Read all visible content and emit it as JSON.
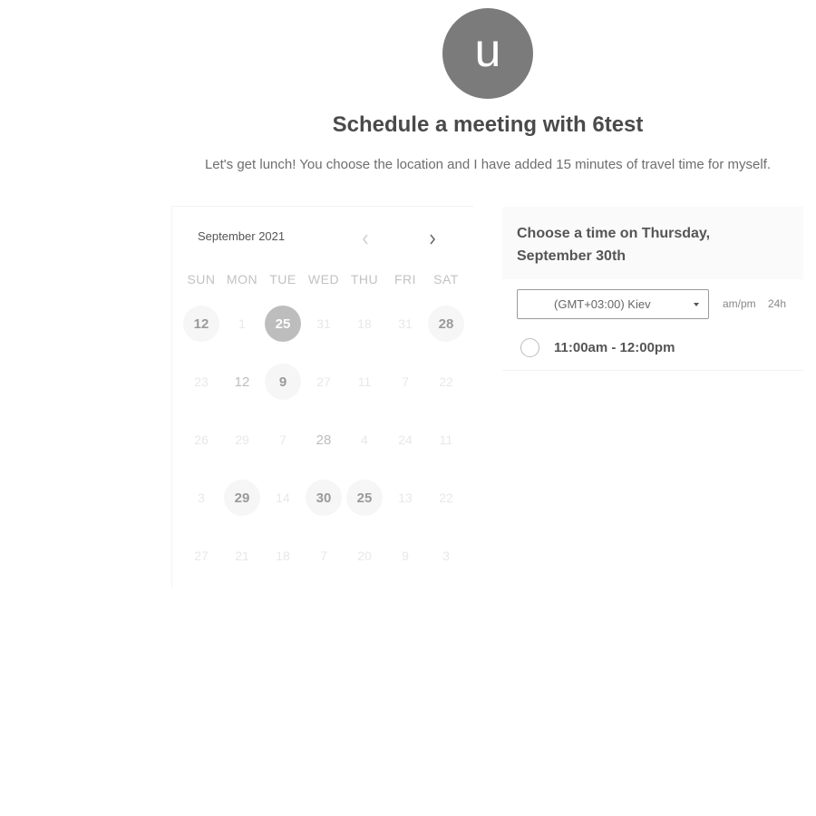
{
  "host": {
    "avatar_initial": "u",
    "title": "Schedule a meeting with 6test",
    "description": "Let's get lunch! You choose the location and I have added 15 minutes of travel time for myself."
  },
  "calendar": {
    "month_label": "September 2021",
    "prev_icon": "chevron-left-icon",
    "next_icon": "chevron-right-icon",
    "weekdays": [
      "SUN",
      "MON",
      "TUE",
      "WED",
      "THU",
      "FRI",
      "SAT"
    ],
    "weeks": [
      [
        {
          "label": "12",
          "state": "available"
        },
        {
          "label": "1",
          "state": "disabled"
        },
        {
          "label": "25",
          "state": "selected"
        },
        {
          "label": "31",
          "state": "disabled"
        },
        {
          "label": "18",
          "state": "disabled"
        },
        {
          "label": "31",
          "state": "disabled"
        },
        {
          "label": "28",
          "state": "available"
        }
      ],
      [
        {
          "label": "23",
          "state": "disabled"
        },
        {
          "label": "12",
          "state": "muted"
        },
        {
          "label": "9",
          "state": "available"
        },
        {
          "label": "27",
          "state": "disabled"
        },
        {
          "label": "11",
          "state": "disabled"
        },
        {
          "label": "7",
          "state": "disabled"
        },
        {
          "label": "22",
          "state": "disabled"
        }
      ],
      [
        {
          "label": "26",
          "state": "disabled"
        },
        {
          "label": "29",
          "state": "disabled"
        },
        {
          "label": "7",
          "state": "disabled"
        },
        {
          "label": "28",
          "state": "muted"
        },
        {
          "label": "4",
          "state": "disabled"
        },
        {
          "label": "24",
          "state": "disabled"
        },
        {
          "label": "11",
          "state": "disabled"
        }
      ],
      [
        {
          "label": "3",
          "state": "disabled"
        },
        {
          "label": "29",
          "state": "available"
        },
        {
          "label": "14",
          "state": "disabled"
        },
        {
          "label": "30",
          "state": "available"
        },
        {
          "label": "25",
          "state": "available"
        },
        {
          "label": "13",
          "state": "disabled"
        },
        {
          "label": "22",
          "state": "disabled"
        }
      ],
      [
        {
          "label": "27",
          "state": "disabled"
        },
        {
          "label": "21",
          "state": "disabled"
        },
        {
          "label": "18",
          "state": "disabled"
        },
        {
          "label": "7",
          "state": "disabled"
        },
        {
          "label": "20",
          "state": "disabled"
        },
        {
          "label": "9",
          "state": "disabled"
        },
        {
          "label": "3",
          "state": "disabled"
        }
      ]
    ]
  },
  "times": {
    "heading": "Choose a time on Thursday, September 30th",
    "timezone": "(GMT+03:00) Kiev",
    "format_ampm": "am/pm",
    "format_24h": "24h",
    "slots": [
      {
        "label": "11:00am - 12:00pm"
      }
    ]
  },
  "colors": {
    "selected_day": "#bdbdbd",
    "available_day_bg": "#f6f6f6",
    "avatar_bg": "#7b7b7b"
  }
}
